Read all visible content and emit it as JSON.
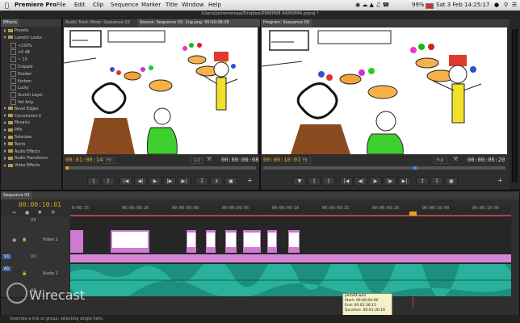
{
  "menubar": {
    "app": "Premiere Pro",
    "items": [
      "File",
      "Edit",
      "Clip",
      "Sequence",
      "Marker",
      "Title",
      "Window",
      "Help"
    ],
    "battery": "99%",
    "datetime": "Sat 3 Feb  14:25:17"
  },
  "window_title": "/Users/jochemsmaal/Dropbox/PKM/PKM 44/PKM44.prproj *",
  "effects_panel": {
    "tab": "Effects",
    "items": [
      {
        "label": "Presets",
        "kind": "folder",
        "indent": 0
      },
      {
        "label": "Lumetri Looks",
        "kind": "folder",
        "indent": 0
      },
      {
        "label": "<150%",
        "kind": "fx",
        "indent": 1
      },
      {
        "label": "+0 dB",
        "kind": "fx",
        "indent": 1
      },
      {
        "label": "~ 10",
        "kind": "fx",
        "indent": 1
      },
      {
        "label": "Croppie",
        "kind": "fx",
        "indent": 1
      },
      {
        "label": "Donker",
        "kind": "fx",
        "indent": 1
      },
      {
        "label": "Korben",
        "kind": "fx",
        "indent": 1
      },
      {
        "label": "Lucky",
        "kind": "fx",
        "indent": 1
      },
      {
        "label": "Scotch Layer",
        "kind": "fx",
        "indent": 1
      },
      {
        "label": "Vet Arty",
        "kind": "fx",
        "indent": 1
      },
      {
        "label": "Bevel Edges",
        "kind": "folder",
        "indent": 0
      },
      {
        "label": "Convolution K",
        "kind": "folder",
        "indent": 0
      },
      {
        "label": "Mosaics",
        "kind": "folder",
        "indent": 0
      },
      {
        "label": "PiPs",
        "kind": "folder",
        "indent": 0
      },
      {
        "label": "Solarizes",
        "kind": "folder",
        "indent": 0
      },
      {
        "label": "Twirls",
        "kind": "folder",
        "indent": 0
      },
      {
        "label": "Audio Effects",
        "kind": "folder",
        "indent": 0
      },
      {
        "label": "Audio Transitions",
        "kind": "folder",
        "indent": 0
      },
      {
        "label": "Video Effects",
        "kind": "folder",
        "indent": 0
      }
    ]
  },
  "source_monitor": {
    "tabs": [
      "Audio Track Mixer: Sequence 03",
      "Source: Sequence 03: 2ng.png: 00:00:08:08"
    ],
    "timecode_in": "00:01:00:14",
    "fit": "Fit",
    "quality": "1/2",
    "timecode_out": "00:00:00:08"
  },
  "program_monitor": {
    "tab": "Program: Sequence 03",
    "timecode_in": "00:00:10:01",
    "fit": "Fit",
    "quality": "Full",
    "timecode_out": "00:00:06:20"
  },
  "timeline": {
    "tab": "Sequence 03",
    "timecode": "00:00:10:01",
    "ruler": [
      "0:08:15",
      "00:00:08:20",
      "00:00:09:00",
      "00:00:09:05",
      "00:00:09:10",
      "00:00:09:15",
      "00:00:09:20",
      "00:00:10:00",
      "00:00:10:05"
    ],
    "tracks": [
      {
        "id": "V3",
        "name": ""
      },
      {
        "id": "V2",
        "name": "Video 2"
      },
      {
        "id": "V1",
        "name": "V1"
      },
      {
        "id": "A1",
        "name": "Audio 1"
      },
      {
        "id": "A2",
        "name": "A2"
      }
    ],
    "tooltip": {
      "name": "pkm44.wav",
      "start": "Start: 00:00:00:00",
      "end": "End: 00:01:36:15",
      "duration": "Duration: 00:01:36:16"
    }
  },
  "statusbar": "Override a link or group, selecting single item.",
  "watermark": "Wirecast",
  "colors": {
    "accent": "#e8a21b",
    "clip_pink": "#cf7ad0",
    "audio_teal": "#1c8f7e"
  }
}
